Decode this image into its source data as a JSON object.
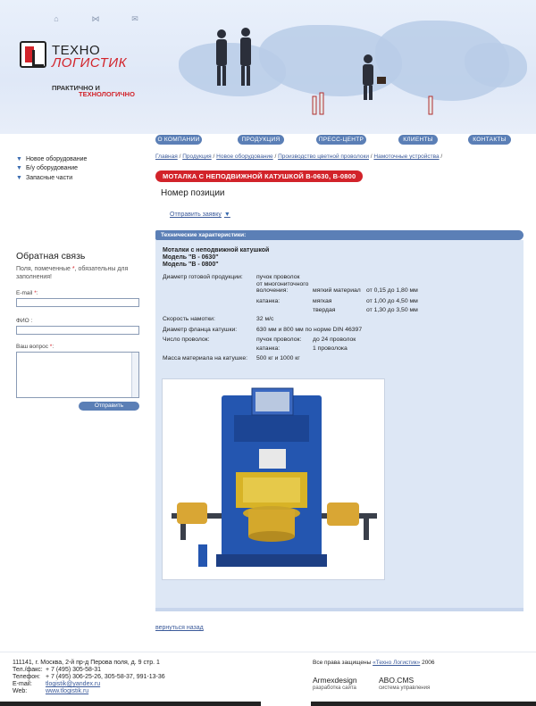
{
  "header": {
    "logo_line1": "ТЕХНО",
    "logo_line2": "ЛОГИСТИК",
    "slogan_line1": "ПРАКТИЧНО И",
    "slogan_line2": "ТЕХНОЛОГИЧНО",
    "icons": [
      "home-icon",
      "sitemap-icon",
      "mail-icon"
    ]
  },
  "nav": [
    "О КОМПАНИИ",
    "ПРОДУКЦИЯ",
    "ПРЕСС-ЦЕНТР",
    "КЛИЕНТЫ",
    "КОНТАКТЫ"
  ],
  "sidebar": {
    "items": [
      "Новое оборудование",
      "Б/у оборудование",
      "Запасные части"
    ]
  },
  "feedback": {
    "title": "Обратная связь",
    "note": "Поля, помеченные",
    "note_tail": ", обязательны для заполнения!",
    "email_label": "E-mail",
    "name_label": "ФИО :",
    "question_label": "Ваш вопрос",
    "submit": "Отправить"
  },
  "breadcrumbs": [
    "Главная",
    "Продукция",
    "Новое оборудование",
    "Производство цветной проволоки",
    "Намоточные устройства"
  ],
  "product": {
    "title": "МОТАЛКА С НЕПОДВИЖНОЙ КАТУШКОЙ В-0630, В-0800",
    "position_title": "Номер позиции",
    "order_link": "Отправить заявку",
    "spec_header": "Технические характеристики:"
  },
  "specs": {
    "head1": "Моталки с неподвижной катушкой",
    "head2": "Модель \"B - 0630\"",
    "head3": "Модель \"B - 0800\"",
    "diam_label": "Диаметр готовой продукции:",
    "bundle": "пучок проволок",
    "from_multi": "от многониточного",
    "twisting": "волочения:",
    "soft_wire": "мягкий материал",
    "soft_wire_val": "от 0,15 до 1,80 мм",
    "rolling": "катанка:",
    "soft": "мягкая",
    "soft_val": "от 1,00 до 4,50 мм",
    "hard": "твердая",
    "hard_val": "от 1,30 до 3,50 мм",
    "speed_label": "Скорость намотки:",
    "speed_val": "32 м/с",
    "flange_label": "Диаметр фланца катушки:",
    "flange_val": "630 мм и 800 мм по норме DIN 46397",
    "wires_label": "Число проволок:",
    "wires_bundle": "пучок проволок:",
    "wires_bundle_val": "до 24 проволок",
    "wires_rolling": "катанка:",
    "wires_rolling_val": "1 проволока",
    "mass_label": "Масса материала на катушке:",
    "mass_val": "500 кг и 1000 кг"
  },
  "back_link": "вернуться назад",
  "footer": {
    "address": "111141, г. Москва, 2-й пр-д Перова поля, д. 9 стр. 1",
    "tel_fax_label": "Тел./факс:",
    "tel_fax": "+ 7 (495) 305-58-31",
    "phone_label": "Телефон:",
    "phone": "+ 7 (495) 306-25-26, 305-58-37, 991-13-36",
    "email_label": "E-mail:",
    "email": "tlogistik@yandex.ru",
    "web_label": "Web:",
    "web": "www.tlogistik.ru",
    "copyright_prefix": "Все права защищены",
    "copyright_link": "«Техно Логистик»",
    "copyright_year": "2006",
    "dev1_name": "Armexdesign",
    "dev1_sub": "разработка сайта",
    "dev2_name": "ABO.CMS",
    "dev2_sub": "система управления"
  },
  "colors": {
    "brand_red": "#d2232a",
    "accent_blue": "#5b7fb6",
    "panel": "#dde7f5"
  }
}
